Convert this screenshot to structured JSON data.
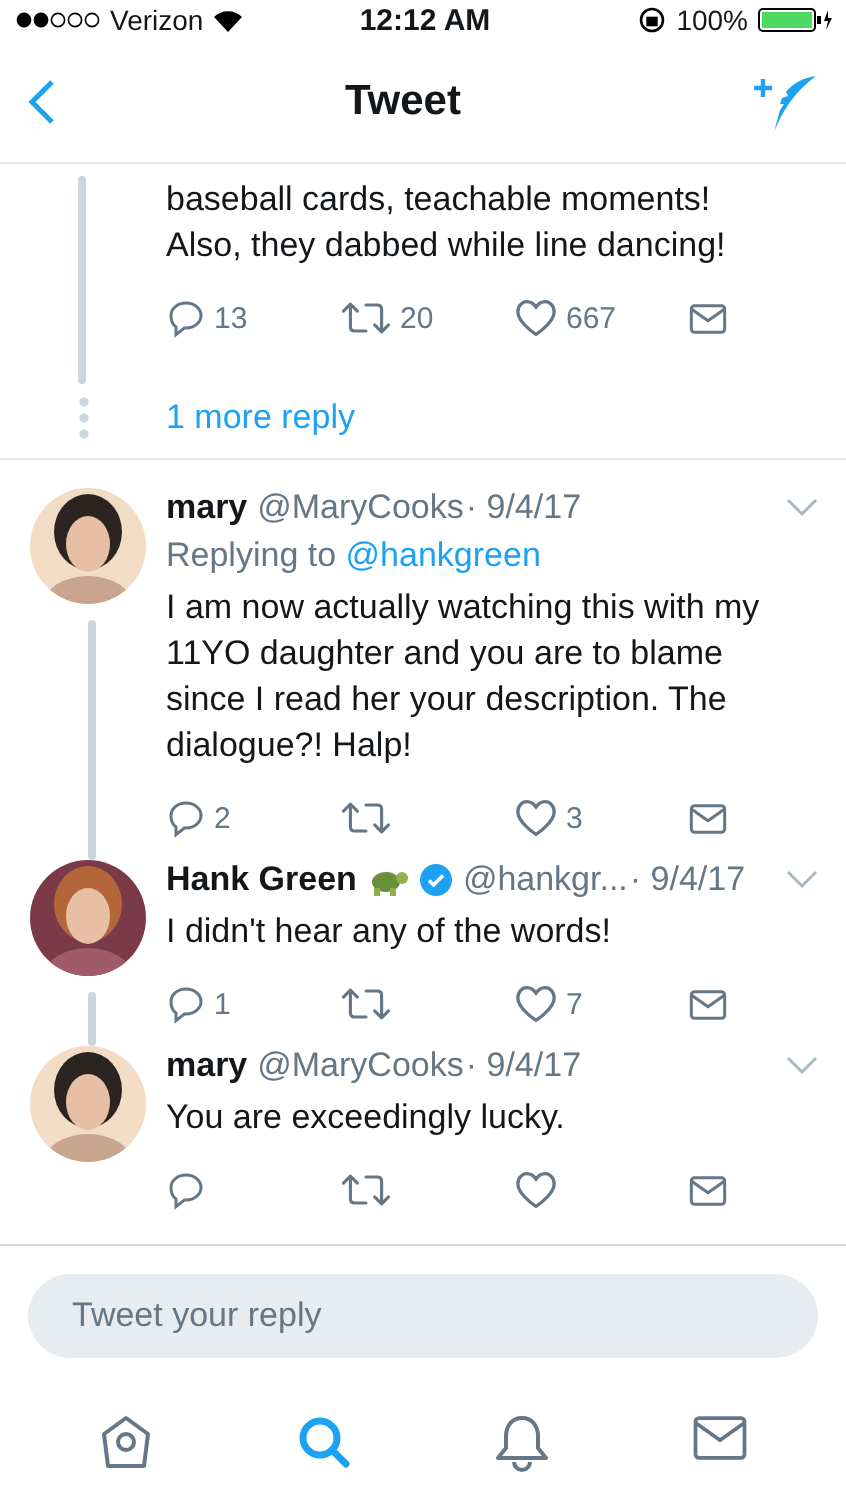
{
  "status_bar": {
    "carrier": "Verizon",
    "time": "12:12 AM",
    "battery": "100%"
  },
  "nav": {
    "title": "Tweet"
  },
  "partial_tweet": {
    "lines": [
      "baseball cards, teachable moments!",
      "Also, they dabbed while line dancing!"
    ],
    "replies": "13",
    "retweets": "20",
    "likes": "667"
  },
  "more_replies": "1 more reply",
  "tweets": [
    {
      "name": "mary",
      "handle": "@MaryCooks",
      "date": "· 9/4/17",
      "replying_label": "Replying to",
      "replying_to": "@hankgreen",
      "text": "I am now actually watching this with my 11YO daughter and you are to blame since I read her your description. The dialogue?! Halp!",
      "verified": false,
      "emoji": false,
      "connected": true,
      "replies": "2",
      "likes": "3"
    },
    {
      "name": "Hank Green",
      "handle": "@hankgr...",
      "date": "· 9/4/17",
      "text": "I didn't hear any of the words!",
      "verified": true,
      "emoji": true,
      "connected": true,
      "replies": "1",
      "likes": "7"
    },
    {
      "name": "mary",
      "handle": "@MaryCooks",
      "date": "· 9/4/17",
      "text": "You are exceedingly lucky.",
      "verified": false,
      "emoji": false,
      "connected": false
    }
  ],
  "reply_field": {
    "placeholder": "Tweet your reply"
  },
  "tab_bar": [
    {
      "kind": "home",
      "selected": false
    },
    {
      "kind": "search",
      "selected": true
    },
    {
      "kind": "notifications",
      "selected": false
    },
    {
      "kind": "messages",
      "selected": false
    }
  ]
}
